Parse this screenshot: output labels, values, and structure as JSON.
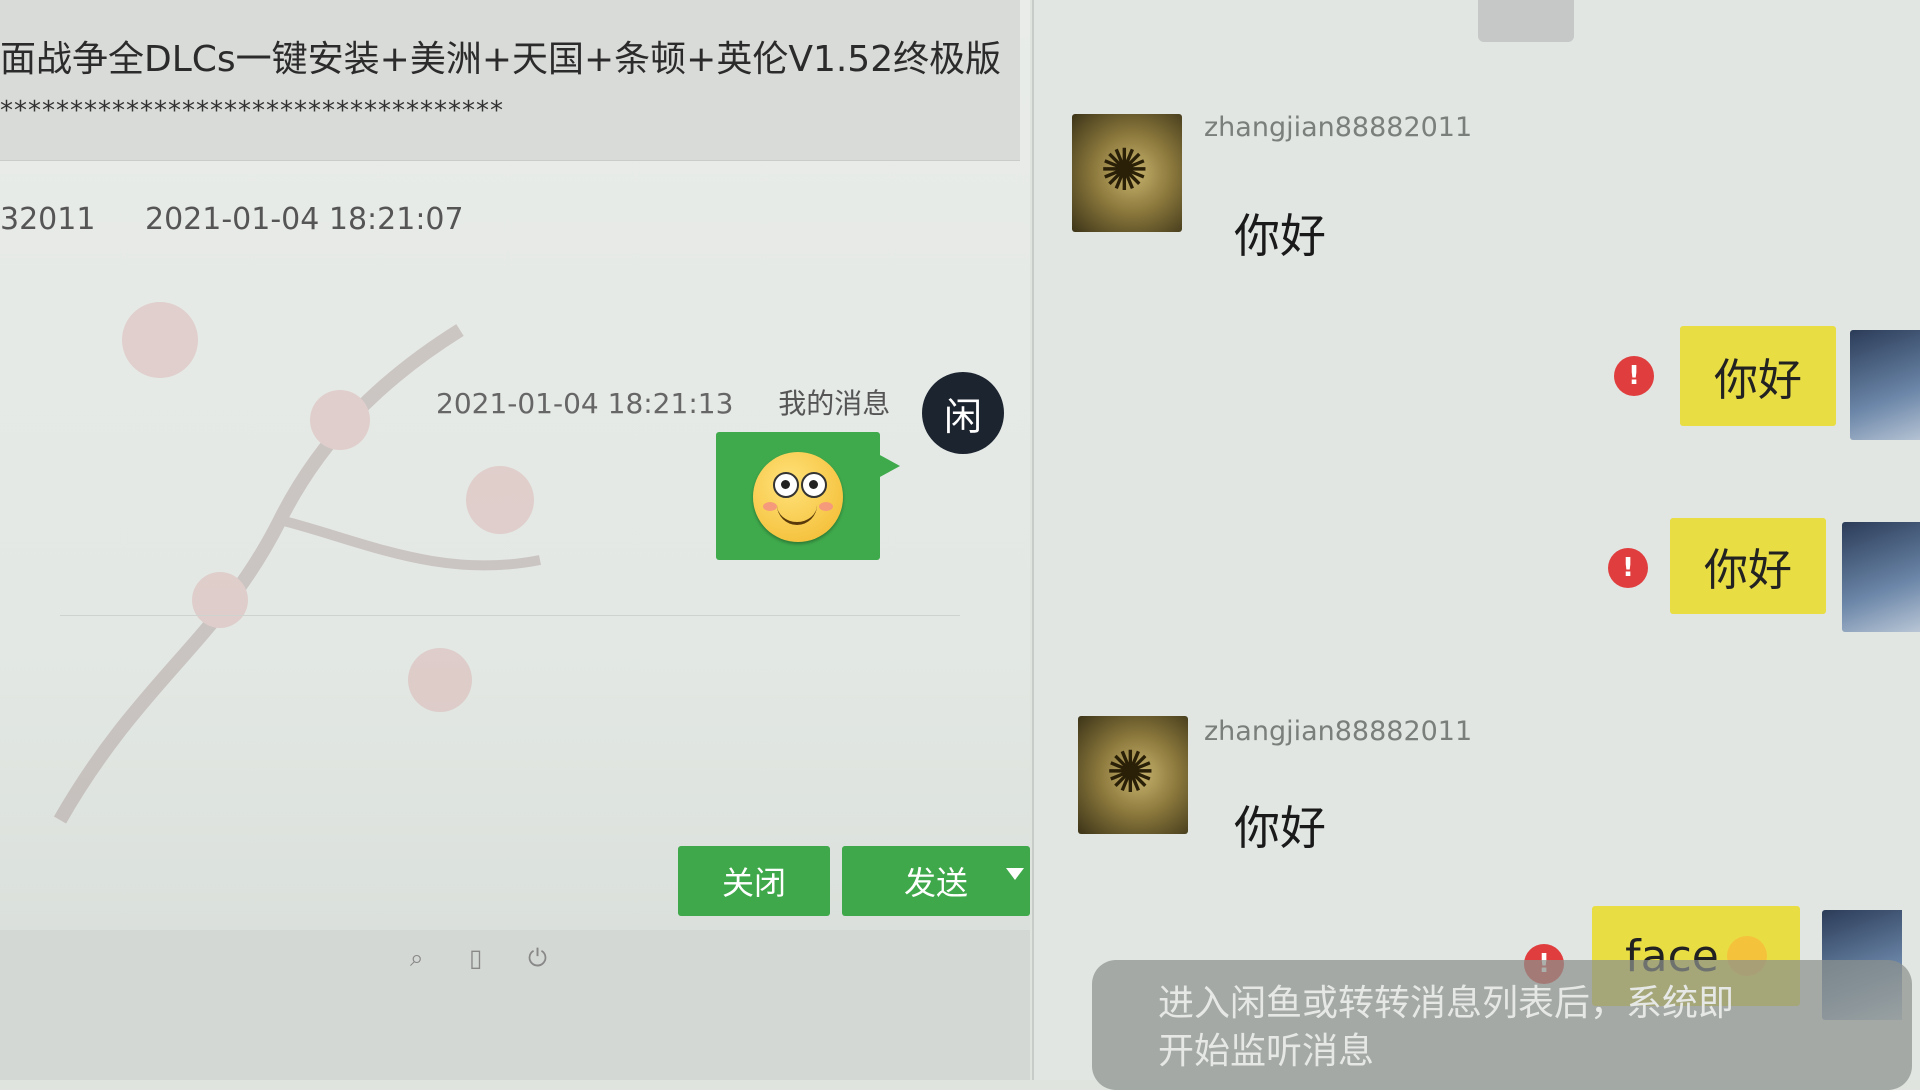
{
  "left_panel": {
    "title": "面战争全DLCs一键安装+美洲+天国+条顿+英伦V1.52终极版",
    "stars": "************************************",
    "first_message": {
      "sender": "32011",
      "time": "2021-01-04 18:21:07"
    },
    "my_message": {
      "time": "2021-01-04 18:21:13",
      "label": "我的消息",
      "badge": "闲"
    },
    "buttons": {
      "close": "关闭",
      "send": "发送"
    }
  },
  "right_panel": {
    "messages": [
      {
        "type": "received",
        "user": "zhangjian88882011",
        "text": "你好"
      },
      {
        "type": "sent",
        "text": "你好",
        "status": "!"
      },
      {
        "type": "sent",
        "text": "你好",
        "status": "!"
      },
      {
        "type": "received",
        "user": "zhangjian88882011",
        "text": "你好"
      },
      {
        "type": "sent",
        "text": "face",
        "status": "!"
      }
    ],
    "toast": {
      "line1": "进入闲鱼或转转消息列表后，系统即",
      "line2": "开始监听消息"
    }
  },
  "colors": {
    "green": "#3fa84b",
    "yellow_bubble": "#e9dd44",
    "error": "#e03e3e"
  },
  "icons": [
    "smiley-emoji-icon",
    "chevron-down-icon",
    "error-icon"
  ]
}
